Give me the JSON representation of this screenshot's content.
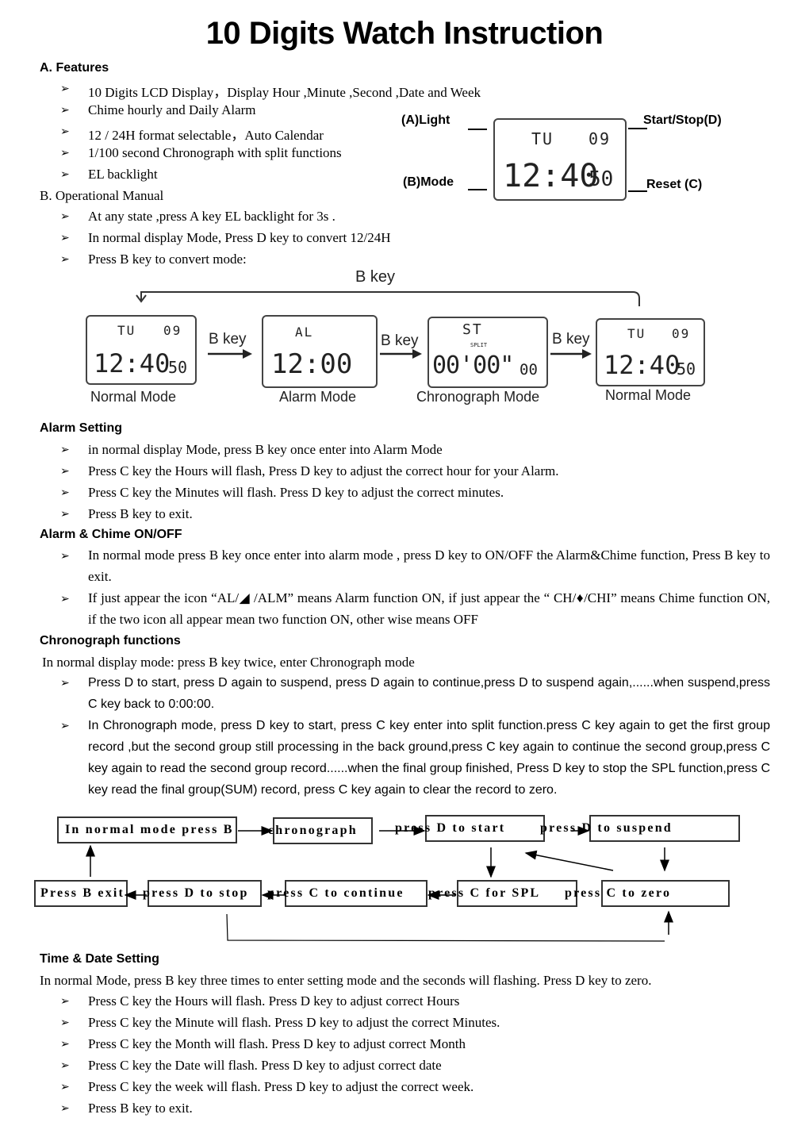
{
  "title": "10 Digits Watch Instruction",
  "features": {
    "heading": "A. Features",
    "items": [
      "10 Digits LCD Display，Display Hour ,Minute ,Second ,Date and Week",
      "Chime hourly and Daily Alarm",
      "12 / 24H format selectable，Auto Calendar",
      "1/100 second Chronograph with split functions",
      "EL backlight"
    ]
  },
  "watch_diagram": {
    "light_label": "(A)Light",
    "mode_label": "(B)Mode",
    "start_stop_label": "Start/Stop(D)",
    "reset_label": "Reset (C)",
    "day": "TU",
    "date": "09",
    "time": "12:40",
    "seconds": "50"
  },
  "operational": {
    "heading": "B. Operational Manual",
    "items": [
      "At any state ,press A key EL backlight for 3s .",
      "In normal display Mode, Press D key to convert 12/24H",
      "Press B key to convert mode:"
    ]
  },
  "mode_flow": {
    "loop_label": "B key",
    "arrow_label": "B key",
    "modes": [
      {
        "name": "Normal Mode",
        "top_left": "TU",
        "top_right": "09",
        "main": "12:40",
        "small": "50"
      },
      {
        "name": "Alarm Mode",
        "top_left": "AL",
        "top_right": "",
        "main": "12:00",
        "small": ""
      },
      {
        "name": "Chronograph Mode",
        "top_left": "ST",
        "sub": "SPLIT",
        "main": "00'00\"",
        "small": "00"
      },
      {
        "name": "Normal Mode",
        "top_left": "TU",
        "top_right": "09",
        "main": "12:40",
        "small": "50"
      }
    ]
  },
  "alarm_setting": {
    "heading": "Alarm Setting",
    "items": [
      "in normal display Mode, press B key once enter into Alarm Mode",
      "Press C key the Hours will flash, Press D key to adjust the correct hour for your Alarm.",
      "Press C key the Minutes will flash. Press D key to adjust the correct minutes.",
      "Press B key to exit."
    ]
  },
  "alarm_chime": {
    "heading": "Alarm & Chime ON/OFF",
    "items": [
      "In normal mode press B key once enter into alarm mode , press D key to ON/OFF the Alarm&Chime function, Press B key to exit.",
      "If just appear the icon “AL/◢ /ALM” means Alarm function ON, if just appear the “ CH/♦/CHI” means Chime function ON, if the two icon all appear mean two function ON, other wise means OFF"
    ]
  },
  "chronograph": {
    "heading": "Chronograph functions",
    "intro": "In normal display mode: press B key twice, enter Chronograph mode",
    "items": [
      "Press D to start, press D again to suspend, press D again to continue,press D to suspend again,......when suspend,press C key back to 0:00:00.",
      "In Chronograph mode, press D key to start, press C key enter into split function.press C key again to get the first group record ,but the second group still processing in the back ground,press C key again to continue the second group,press C key again to read the second group record......when the final group finished, Press D key to stop the SPL function,press C key read the final group(SUM) record, press C key again to clear the record to zero."
    ]
  },
  "flowchart": {
    "top": [
      "In normal mode press B",
      "chronograph",
      "press D to start",
      "press D to suspend"
    ],
    "bottom": [
      "Press B exit",
      "press D to stop",
      "press C to continue",
      "press C for SPL",
      "press C to zero"
    ]
  },
  "time_date": {
    "heading": "Time & Date Setting",
    "intro": "In normal Mode, press B key three times to enter setting mode and the seconds will flashing. Press D key to zero.",
    "items": [
      "Press C key the Hours will flash. Press D key to adjust correct Hours",
      "Press C key the Minute will flash. Press D key to adjust the correct Minutes.",
      "Press C key the Month will flash. Press D key to adjust correct Month",
      "Press C key the Date will flash. Press D key to adjust correct date",
      "Press C key the week will flash. Press D key to adjust the correct week.",
      "Press B key to exit."
    ]
  },
  "bullet_glyph": "➢"
}
